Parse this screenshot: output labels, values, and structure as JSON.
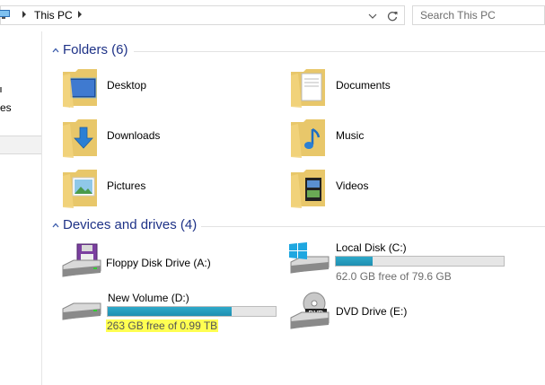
{
  "address_bar": {
    "breadcrumb": [
      "This PC"
    ],
    "search_placeholder": "Search This PC"
  },
  "nav_pane": {
    "partial_text": "es"
  },
  "folders_group": {
    "title": "Folders (6)",
    "items": [
      {
        "label": "Desktop",
        "icon": "desktop-folder-icon"
      },
      {
        "label": "Documents",
        "icon": "documents-folder-icon"
      },
      {
        "label": "Downloads",
        "icon": "downloads-folder-icon"
      },
      {
        "label": "Music",
        "icon": "music-folder-icon"
      },
      {
        "label": "Pictures",
        "icon": "pictures-folder-icon"
      },
      {
        "label": "Videos",
        "icon": "videos-folder-icon"
      }
    ]
  },
  "drives_group": {
    "title": "Devices and drives (4)",
    "items": [
      {
        "name": "Floppy Disk Drive (A:)",
        "icon": "floppy-drive-icon"
      },
      {
        "name": "Local Disk (C:)",
        "icon": "windows-drive-icon",
        "free": "62.0 GB free of 79.6 GB",
        "used_fraction": 0.22
      },
      {
        "name": "New Volume (D:)",
        "icon": "hard-drive-icon",
        "free": "263 GB free of 0.99 TB",
        "used_fraction": 0.74,
        "highlighted": true
      },
      {
        "name": "DVD Drive (E:)",
        "icon": "dvd-drive-icon",
        "badge": "DVD"
      }
    ]
  },
  "colors": {
    "group_header": "#1e3287",
    "capacity_fill": "#26a0da",
    "highlight": "#ffff52"
  }
}
